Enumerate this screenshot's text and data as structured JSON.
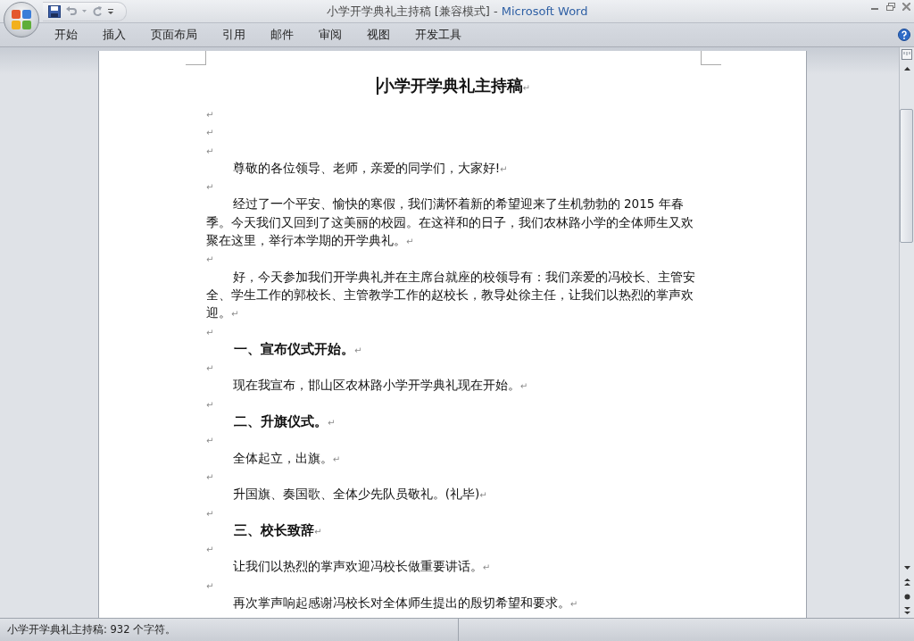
{
  "window": {
    "title": "小学开学典礼主持稿 [兼容模式]",
    "separator": "-",
    "app": "Microsoft Word"
  },
  "tabs": [
    {
      "label": "开始",
      "selected": false
    },
    {
      "label": "插入",
      "selected": false
    },
    {
      "label": "页面布局",
      "selected": false
    },
    {
      "label": "引用",
      "selected": false
    },
    {
      "label": "邮件",
      "selected": false
    },
    {
      "label": "审阅",
      "selected": false
    },
    {
      "label": "视图",
      "selected": false
    },
    {
      "label": "开发工具",
      "selected": false
    }
  ],
  "document": {
    "paragraphs": [
      {
        "kind": "title",
        "text": "小学开学典礼主持稿",
        "end_mark": "↵"
      },
      {
        "kind": "empty",
        "end_mark": "↵"
      },
      {
        "kind": "empty",
        "end_mark": "↵"
      },
      {
        "kind": "empty",
        "end_mark": "↵"
      },
      {
        "kind": "body",
        "text": "尊敬的各位领导、老师，亲爱的同学们，大家好!",
        "end_mark": "↵"
      },
      {
        "kind": "empty",
        "end_mark": "↵"
      },
      {
        "kind": "body",
        "text": "经过了一个平安、愉快的寒假，我们满怀着新的希望迎来了生机勃勃的 2015 年春季。今天我们又回到了这美丽的校园。在这祥和的日子，我们农林路小学的全体师生又欢聚在这里，举行本学期的开学典礼。",
        "end_mark": "↵"
      },
      {
        "kind": "empty",
        "end_mark": "↵"
      },
      {
        "kind": "body",
        "text": "好，今天参加我们开学典礼并在主席台就座的校领导有：我们亲爱的冯校长、主管安全、学生工作的郭校长、主管教学工作的赵校长，教导处徐主任，让我们以热烈的掌声欢迎。",
        "end_mark": "↵"
      },
      {
        "kind": "empty",
        "end_mark": "↵"
      },
      {
        "kind": "heading",
        "text": "一、宣布仪式开始。",
        "end_mark": "↵"
      },
      {
        "kind": "empty",
        "end_mark": "↵"
      },
      {
        "kind": "body",
        "text": "现在我宣布，邯山区农林路小学开学典礼现在开始。",
        "end_mark": "↵"
      },
      {
        "kind": "empty",
        "end_mark": "↵"
      },
      {
        "kind": "heading",
        "text": "二、升旗仪式。",
        "end_mark": "↵"
      },
      {
        "kind": "empty",
        "end_mark": "↵"
      },
      {
        "kind": "body",
        "text": "全体起立，出旗。",
        "end_mark": "↵"
      },
      {
        "kind": "empty",
        "end_mark": "↵"
      },
      {
        "kind": "body",
        "text": "升国旗、奏国歌、全体少先队员敬礼。(礼毕)",
        "end_mark": "↵"
      },
      {
        "kind": "empty",
        "end_mark": "↵"
      },
      {
        "kind": "heading",
        "text": "三、校长致辞",
        "end_mark": "↵"
      },
      {
        "kind": "empty",
        "end_mark": "↵"
      },
      {
        "kind": "body",
        "text": "让我们以热烈的掌声欢迎冯校长做重要讲话。",
        "end_mark": "↵"
      },
      {
        "kind": "empty",
        "end_mark": "↵"
      },
      {
        "kind": "body",
        "text": "再次掌声响起感谢冯校长对全体师生提出的殷切希望和要求。",
        "end_mark": "↵"
      }
    ]
  },
  "status_bar": {
    "text": "小学开学典礼主持稿: 932 个字符。"
  }
}
